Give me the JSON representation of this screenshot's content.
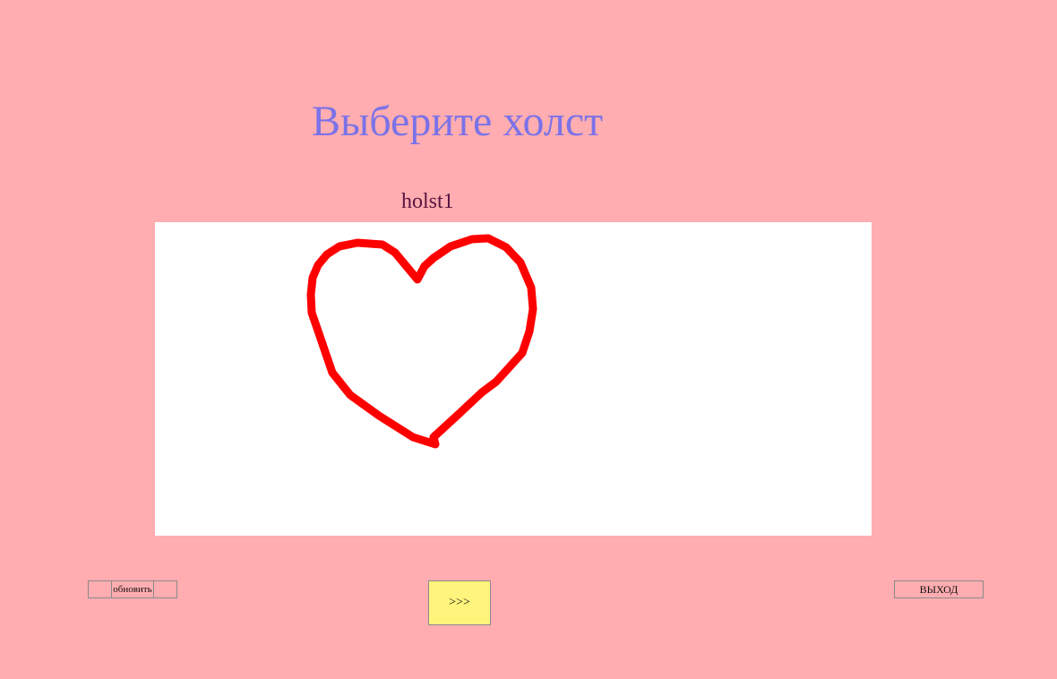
{
  "header": {
    "title": "Выберите холст"
  },
  "canvas": {
    "name": "holst1",
    "drawing": {
      "shape": "heart",
      "stroke_color": "#ff0000",
      "background": "#ffffff"
    }
  },
  "buttons": {
    "refresh_label": "обновить",
    "next_label": ">>>",
    "exit_label": "ВЫХОД"
  },
  "colors": {
    "page_background": "#ffadb0",
    "title": "#7b72e8",
    "canvas_name": "#5a1540",
    "next_button": "#fff47c"
  }
}
